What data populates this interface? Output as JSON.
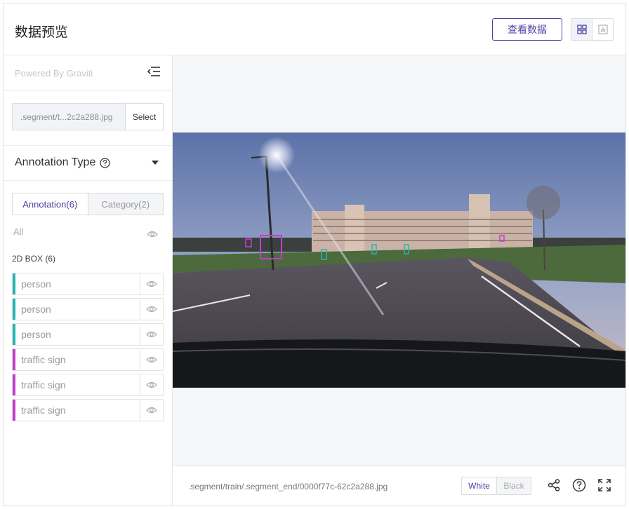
{
  "header": {
    "title": "数据预览",
    "view_data_label": "查看数据",
    "grid_icon": "grid-icon",
    "chart_icon": "bar-chart-icon"
  },
  "sidebar": {
    "powered_by": "Powered By Graviti",
    "file_name": ".segment/t...2c2a288.jpg",
    "select_label": "Select",
    "annotation_type_label": "Annotation Type",
    "tabs": [
      {
        "label": "Annotation(6)",
        "active": true
      },
      {
        "label": "Category(2)",
        "active": false
      }
    ],
    "all_label": "All",
    "box_group_label": "2D BOX (6)",
    "items": [
      {
        "label": "person",
        "color": "#26b5b5"
      },
      {
        "label": "person",
        "color": "#26b5b5"
      },
      {
        "label": "person",
        "color": "#26b5b5"
      },
      {
        "label": "traffic sign",
        "color": "#c43ccf"
      },
      {
        "label": "traffic sign",
        "color": "#c43ccf"
      },
      {
        "label": "traffic sign",
        "color": "#c43ccf"
      }
    ]
  },
  "footer": {
    "path": ".segment/train/.segment_end/0000f77c-62c2a288.jpg",
    "theme_white": "White",
    "theme_black": "Black"
  },
  "colors": {
    "accent": "#4b3fa3",
    "person_box": "#26b5b5",
    "sign_box": "#c43ccf"
  }
}
